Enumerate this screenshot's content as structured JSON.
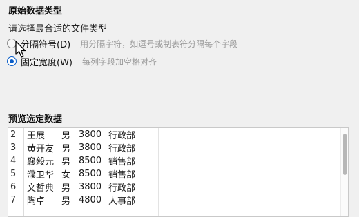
{
  "title": "原始数据类型",
  "prompt": "请选择最合适的文件类型",
  "options": [
    {
      "label": "分隔符号(D)",
      "description": "用分隔字符，如逗号或制表符分隔每个字段",
      "selected": false
    },
    {
      "label": "固定宽度(W)",
      "description": "每列字段加空格对齐",
      "selected": true
    }
  ],
  "preview": {
    "title": "预览选定数据",
    "rows": [
      {
        "line": "2",
        "name": "王展",
        "gender": "男",
        "salary": "3800",
        "dept": "行政部"
      },
      {
        "line": "3",
        "name": "黄开友",
        "gender": "男",
        "salary": "3800",
        "dept": "行政部"
      },
      {
        "line": "4",
        "name": "襄毅元",
        "gender": "男",
        "salary": "8500",
        "dept": "销售部"
      },
      {
        "line": "5",
        "name": "濮卫华",
        "gender": "女",
        "salary": "8500",
        "dept": "销售部"
      },
      {
        "line": "6",
        "name": "文哲典",
        "gender": "男",
        "salary": "3800",
        "dept": "行政部"
      },
      {
        "line": "7",
        "name": "陶卓",
        "gender": "男",
        "salary": "4800",
        "dept": "人事部"
      }
    ]
  },
  "colors": {
    "accent": "#0a5ec8",
    "hint_text": "#9a9a9a",
    "background": "#f0f0f0"
  }
}
